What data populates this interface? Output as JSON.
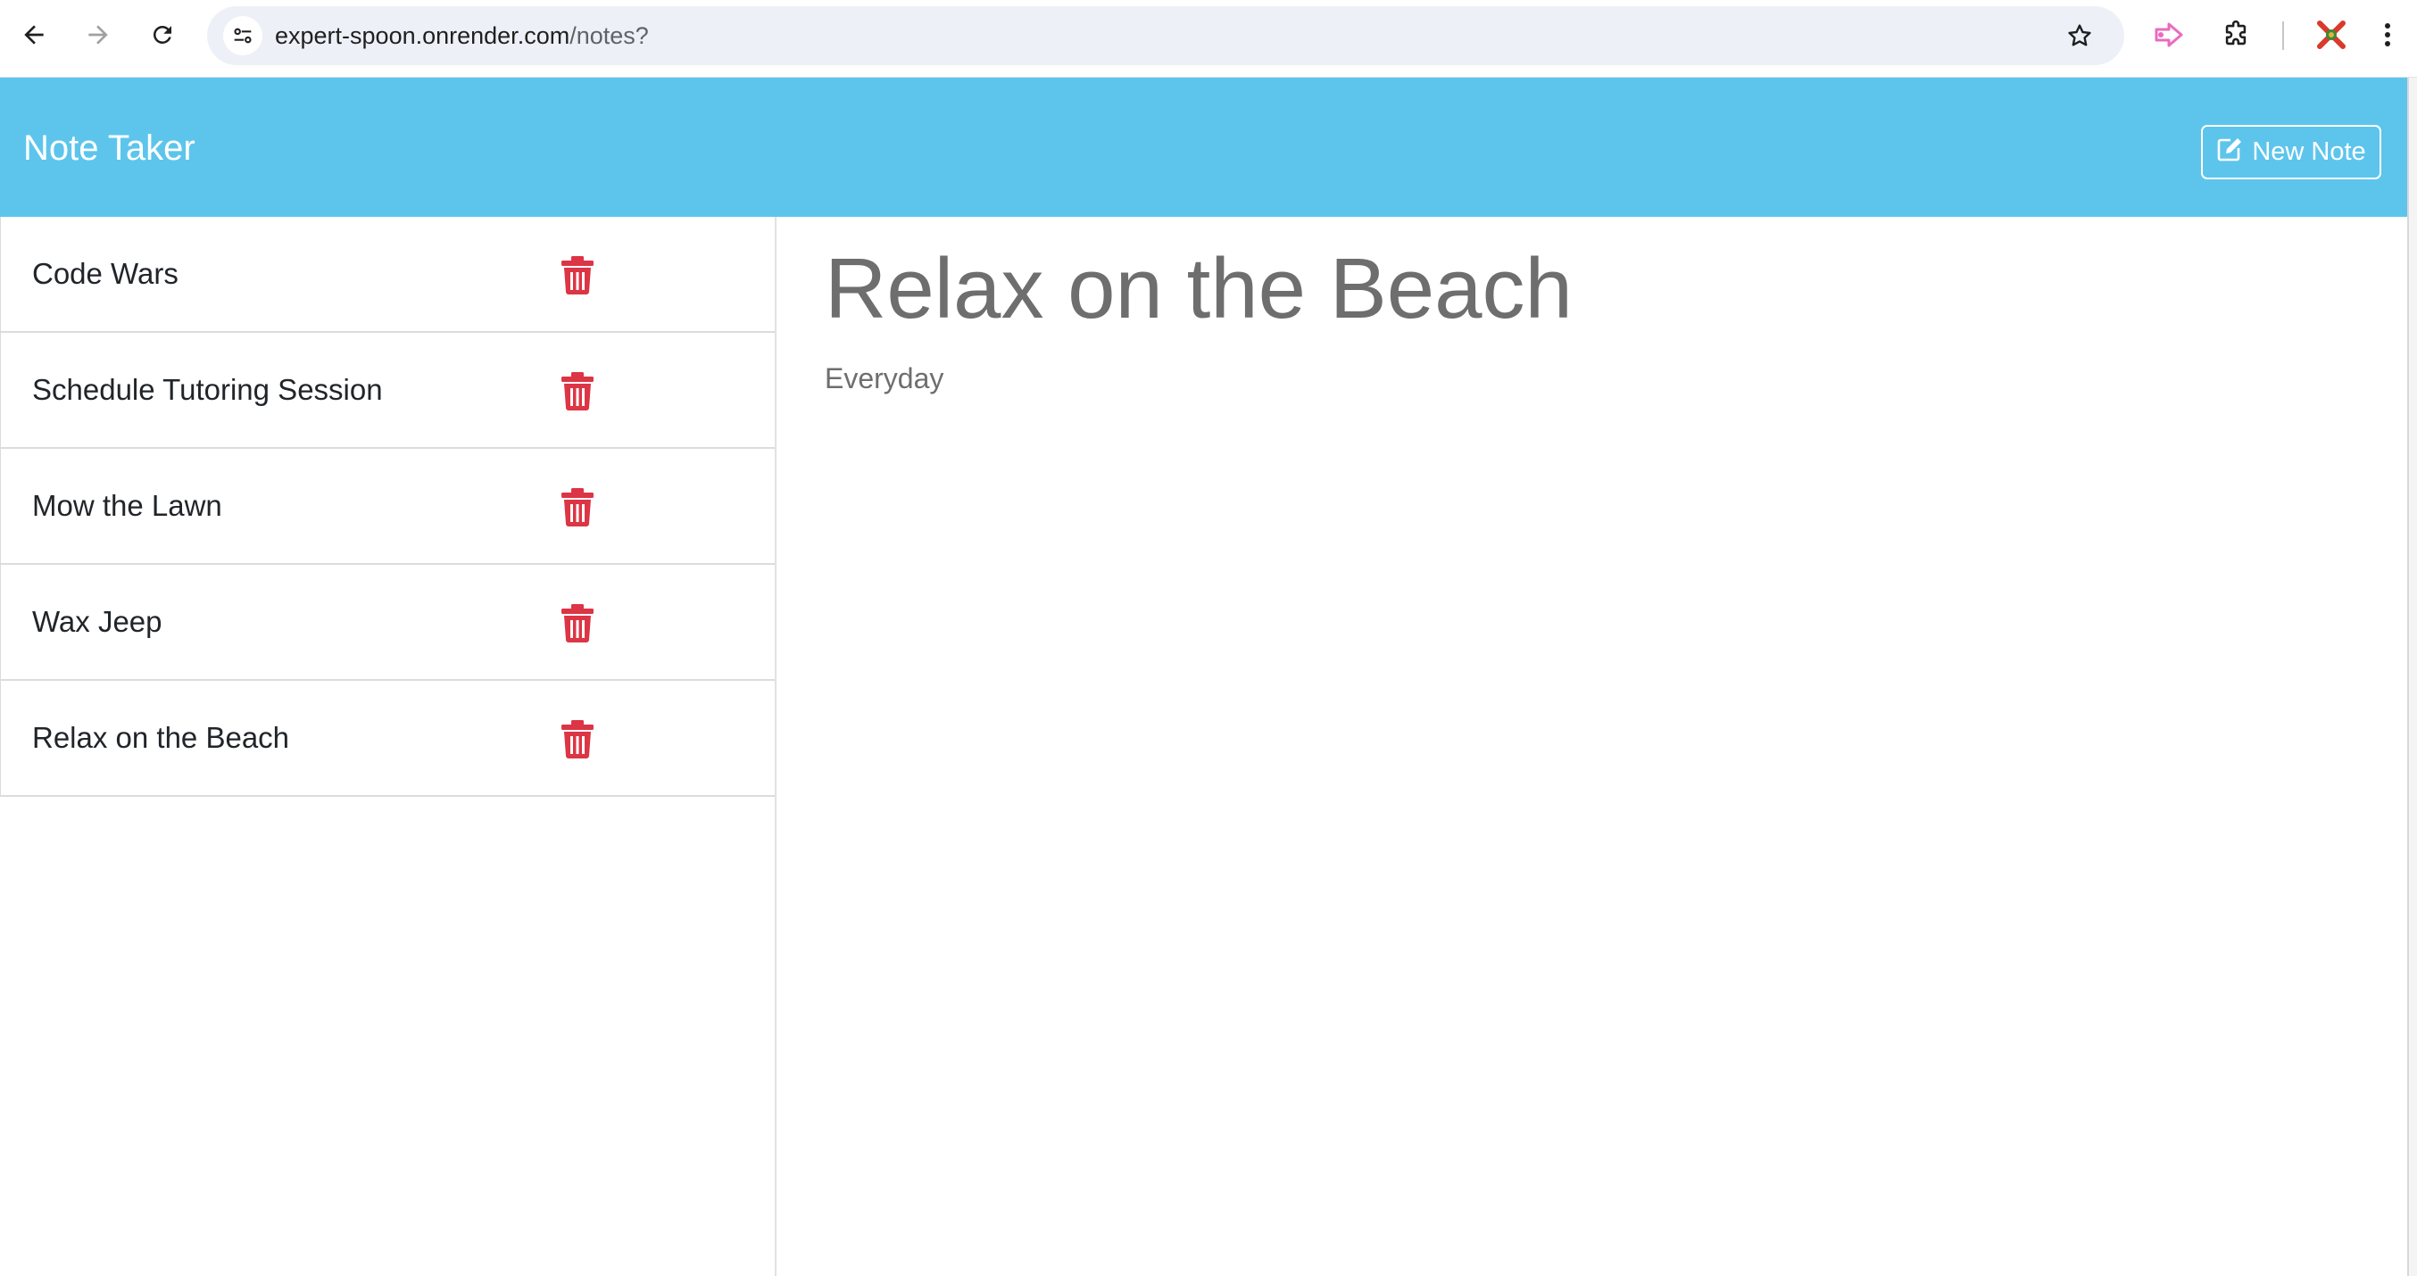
{
  "browser": {
    "url_host": "expert-spoon.onrender.com",
    "url_path": "/notes?"
  },
  "app": {
    "brand": "Note Taker",
    "new_note_label": "New Note"
  },
  "notes": [
    {
      "title": "Code Wars"
    },
    {
      "title": "Schedule Tutoring Session"
    },
    {
      "title": "Mow the Lawn"
    },
    {
      "title": "Wax Jeep"
    },
    {
      "title": "Relax on the Beach"
    }
  ],
  "active_note": {
    "title": "Relax on the Beach",
    "text": "Everyday"
  },
  "colors": {
    "navbar": "#5dc5ec",
    "delete_icon": "#dc3545",
    "note_text": "#6e6e6e"
  }
}
